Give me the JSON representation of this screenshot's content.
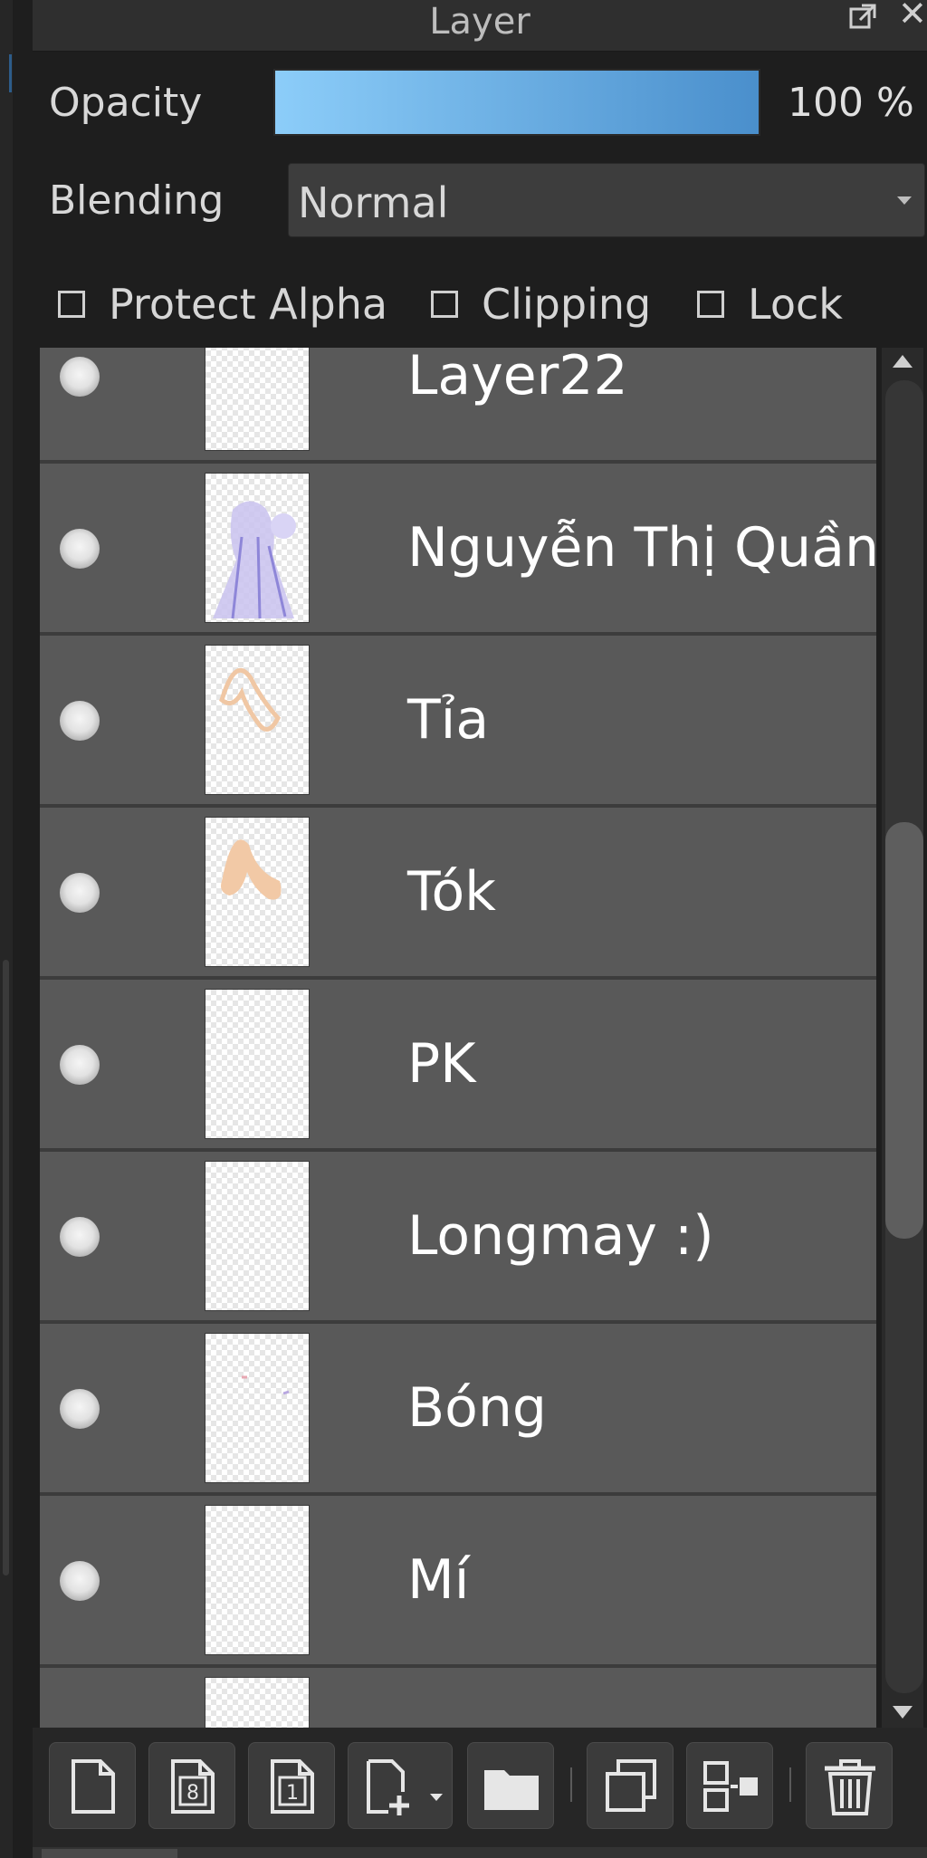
{
  "panel": {
    "title": "Layer"
  },
  "opacity": {
    "label": "Opacity",
    "value": "100 %",
    "level": 1.0
  },
  "blending": {
    "label": "Blending",
    "value": "Normal"
  },
  "options": {
    "protect_alpha": "Protect Alpha",
    "clipping": "Clipping",
    "lock": "Lock"
  },
  "layers": [
    {
      "name": "Layer22"
    },
    {
      "name": "Nguyễn Thị Quần Á"
    },
    {
      "name": "Tỉa"
    },
    {
      "name": "Tók"
    },
    {
      "name": "PK"
    },
    {
      "name": "Longmay :)"
    },
    {
      "name": "Bóng"
    },
    {
      "name": "Mí"
    },
    {
      "name": ""
    }
  ],
  "toolbar": {
    "icons": [
      "new-layer-icon",
      "new-8bit-layer-icon",
      "new-1bit-layer-icon",
      "add-layer-menu-icon",
      "new-folder-icon",
      "duplicate-layer-icon",
      "merge-layer-icon",
      "delete-layer-icon"
    ]
  },
  "colors": {
    "opacity_start": "#8ccdf9",
    "opacity_end": "#4a8fcc",
    "row_bg": "#595959",
    "panel_bg": "#1e1e1e"
  }
}
